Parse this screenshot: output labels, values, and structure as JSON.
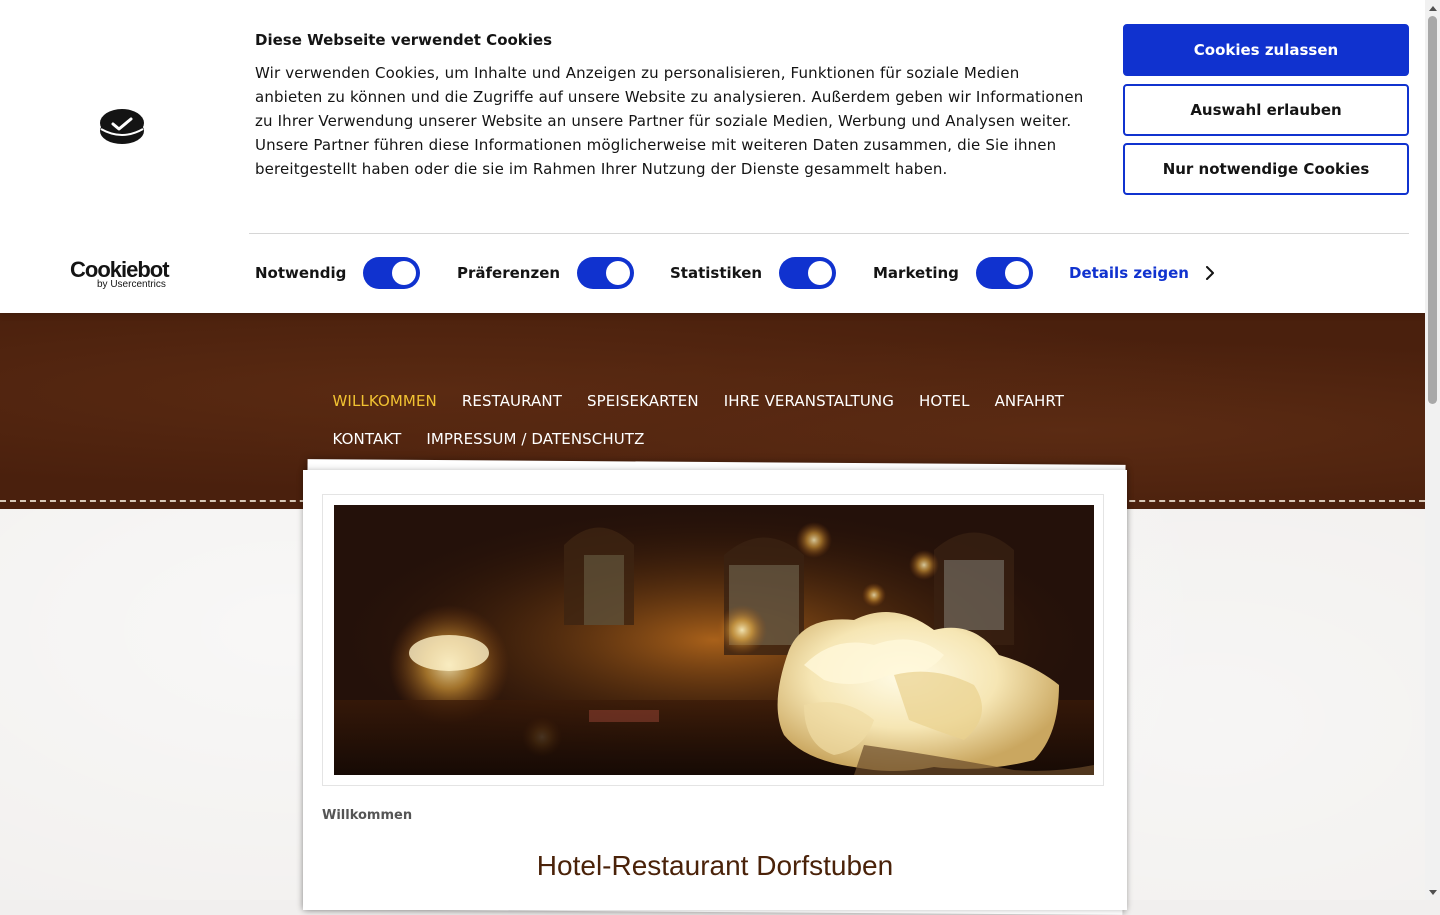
{
  "cookie_banner": {
    "title": "Diese Webseite verwendet Cookies",
    "text": "Wir verwenden Cookies, um Inhalte und Anzeigen zu personalisieren, Funktionen für soziale Medien anbieten zu können und die Zugriffe auf unsere Website zu analysieren. Außerdem geben wir Informationen zu Ihrer Verwendung unserer Website an unsere Partner für soziale Medien, Werbung und Analysen weiter. Unsere Partner führen diese Informationen möglicherweise mit weiteren Daten zusammen, die Sie ihnen bereitgestellt haben oder die sie im Rahmen Ihrer Nutzung der Dienste gesammelt haben.",
    "buttons": {
      "allow_all": "Cookies zulassen",
      "allow_selection": "Auswahl erlauben",
      "necessary_only": "Nur notwendige Cookies"
    },
    "brand": {
      "name": "Cookiebot",
      "sub": "by Usercentrics"
    },
    "toggles": [
      {
        "label": "Notwendig",
        "checked": true
      },
      {
        "label": "Präferenzen",
        "checked": true
      },
      {
        "label": "Statistiken",
        "checked": true
      },
      {
        "label": "Marketing",
        "checked": true
      }
    ],
    "details_link": "Details zeigen",
    "accent_color": "#1032cf"
  },
  "nav": {
    "items": [
      {
        "label": "WILLKOMMEN",
        "active": true
      },
      {
        "label": "RESTAURANT"
      },
      {
        "label": "SPEISEKARTEN"
      },
      {
        "label": "IHRE VERANSTALTUNG"
      },
      {
        "label": "HOTEL"
      },
      {
        "label": "ANFAHRT"
      },
      {
        "label": "KONTAKT"
      },
      {
        "label": "IMPRESSUM / DATENSCHUTZ"
      }
    ],
    "active_color": "#f1c232"
  },
  "content": {
    "breadcrumb": "Willkommen",
    "page_title": "Hotel-Restaurant Dorfstuben"
  },
  "colors": {
    "header_brown": "#4a200d",
    "title_brown": "#4a2209"
  }
}
